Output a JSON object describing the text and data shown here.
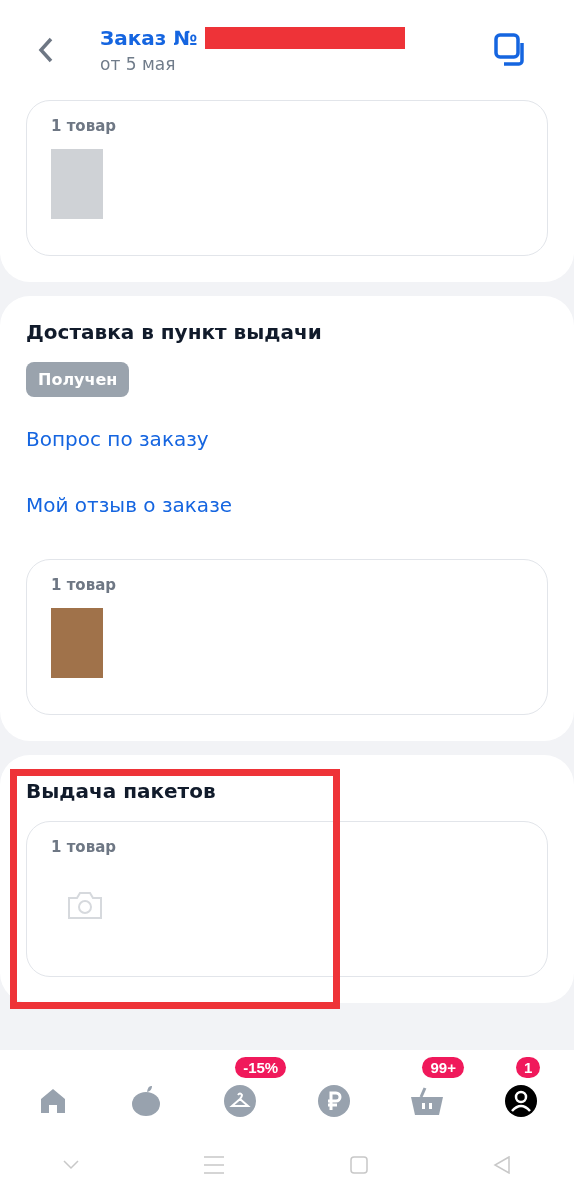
{
  "header": {
    "title": "Заказ №",
    "number_redacted": true,
    "subtitle": "от 5 мая"
  },
  "sections": [
    {
      "highlighted": false,
      "items": {
        "count": "1 товар",
        "thumbnails": [
          {
            "kind": "clothing"
          }
        ]
      }
    },
    {
      "title": "Доставка в пункт выдачи",
      "highlighted": false,
      "status": "Получен",
      "links": [
        "Вопрос по заказу",
        "Мой отзыв о заказе"
      ],
      "items": {
        "count": "1 товар",
        "thumbnails": [
          {
            "kind": "jewelry"
          }
        ]
      }
    },
    {
      "title": "Выдача пакетов",
      "highlighted": true,
      "items": {
        "count": "1 товар",
        "thumbnails": [
          {
            "kind": "placeholder"
          }
        ]
      }
    }
  ],
  "nav": [
    {
      "kind": "home",
      "selected": false
    },
    {
      "kind": "fruit",
      "selected": false
    },
    {
      "kind": "hanger",
      "badge": "-15%",
      "selected": false
    },
    {
      "kind": "ruble",
      "selected": false
    },
    {
      "kind": "basket",
      "badge": "99+",
      "selected": false
    },
    {
      "kind": "profile",
      "badge": "1",
      "selected": true
    }
  ]
}
